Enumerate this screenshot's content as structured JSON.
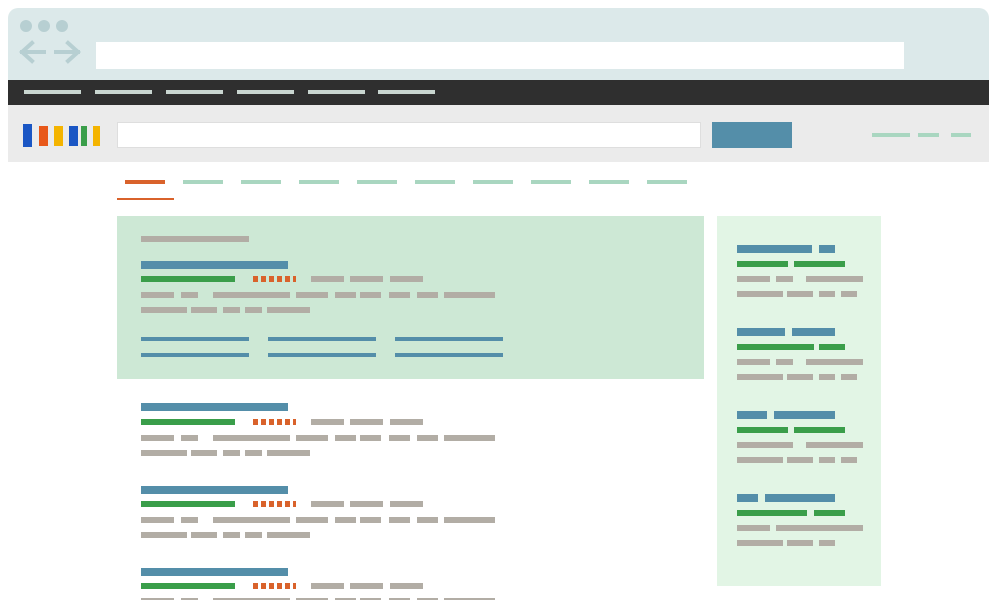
{
  "browser": {
    "window_controls": [
      "close",
      "minimize",
      "maximize"
    ],
    "address_bar_value": "",
    "colors": {
      "chrome": "#dce9ea",
      "navbar": "#2f2f2f"
    }
  },
  "navbar": {
    "item_count": 6
  },
  "header": {
    "logo_colors": [
      "#1a56c4",
      "#e8581a",
      "#f4b400",
      "#1a56c4",
      "#3a9e4a",
      "#f4b400"
    ],
    "search_input_value": "",
    "search_button_label": ""
  },
  "tabs": {
    "count": 10,
    "active_index": 0,
    "colors": {
      "active": "#d9622b",
      "inactive": "#a9d6c0"
    }
  },
  "results": {
    "featured": {
      "background": "#cde8d5",
      "sitelink_rows": 2,
      "sitelink_cols": 3
    },
    "result_count_visible": 4
  },
  "sidebar": {
    "background": "#e2f5e5",
    "block_count": 4
  }
}
